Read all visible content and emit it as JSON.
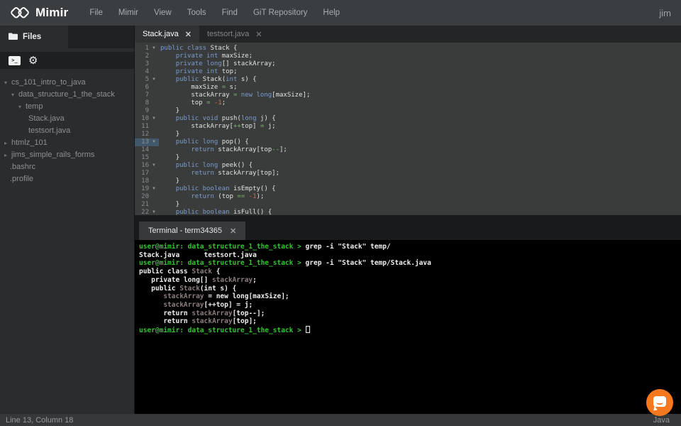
{
  "topbar": {
    "brand": "Mimir",
    "menus": [
      "File",
      "Mimir",
      "View",
      "Tools",
      "Find",
      "GiT Repository",
      "Help"
    ],
    "user": "jim"
  },
  "sidebar": {
    "files_tab": "Files",
    "toolbar_icons": [
      "terminal-icon",
      "gear-icon"
    ],
    "tree": [
      {
        "label": "cs_101_intro_to_java",
        "arrow": "down",
        "indent": 6
      },
      {
        "label": "data_structure_1_the_stack",
        "arrow": "down",
        "indent": 16
      },
      {
        "label": "temp",
        "arrow": "down",
        "indent": 26
      },
      {
        "label": "Stack.java",
        "arrow": "none",
        "indent": 40
      },
      {
        "label": "testsort.java",
        "arrow": "none",
        "indent": 40
      },
      {
        "label": "htmlz_101",
        "arrow": "right",
        "indent": 6
      },
      {
        "label": "jims_simple_rails_forms",
        "arrow": "right",
        "indent": 6
      },
      {
        "label": ".bashrc",
        "arrow": "none",
        "indent": 14
      },
      {
        "label": ".profile",
        "arrow": "none",
        "indent": 14
      }
    ]
  },
  "editor": {
    "tabs": [
      {
        "label": "Stack.java",
        "active": true
      },
      {
        "label": "testsort.java",
        "active": false
      }
    ],
    "active_line": 13,
    "fold_lines": [
      1,
      5,
      10,
      13,
      16,
      19,
      22
    ],
    "lines": [
      {
        "n": 1,
        "tokens": [
          [
            "k",
            "public"
          ],
          [
            "p",
            " "
          ],
          [
            "k",
            "class"
          ],
          [
            "p",
            " Stack {"
          ]
        ]
      },
      {
        "n": 2,
        "tokens": [
          [
            "p",
            "    "
          ],
          [
            "k",
            "private"
          ],
          [
            "p",
            " "
          ],
          [
            "k",
            "int"
          ],
          [
            "p",
            " maxSize;"
          ]
        ]
      },
      {
        "n": 3,
        "tokens": [
          [
            "p",
            "    "
          ],
          [
            "k",
            "private"
          ],
          [
            "p",
            " "
          ],
          [
            "k",
            "long"
          ],
          [
            "p",
            "[] stackArray;"
          ]
        ]
      },
      {
        "n": 4,
        "tokens": [
          [
            "p",
            "    "
          ],
          [
            "k",
            "private"
          ],
          [
            "p",
            " "
          ],
          [
            "k",
            "int"
          ],
          [
            "p",
            " top;"
          ]
        ]
      },
      {
        "n": 5,
        "tokens": [
          [
            "p",
            "    "
          ],
          [
            "k",
            "public"
          ],
          [
            "p",
            " Stack("
          ],
          [
            "k",
            "int"
          ],
          [
            "p",
            " s) {"
          ]
        ]
      },
      {
        "n": 6,
        "tokens": [
          [
            "p",
            "        maxSize "
          ],
          [
            "o",
            "="
          ],
          [
            "p",
            " s;"
          ]
        ]
      },
      {
        "n": 7,
        "tokens": [
          [
            "p",
            "        stackArray "
          ],
          [
            "o",
            "="
          ],
          [
            "p",
            " "
          ],
          [
            "k",
            "new"
          ],
          [
            "p",
            " "
          ],
          [
            "k",
            "long"
          ],
          [
            "p",
            "[maxSize];"
          ]
        ]
      },
      {
        "n": 8,
        "tokens": [
          [
            "p",
            "        top "
          ],
          [
            "o",
            "="
          ],
          [
            "p",
            " "
          ],
          [
            "n",
            "-1"
          ],
          [
            "p",
            ";"
          ]
        ]
      },
      {
        "n": 9,
        "tokens": [
          [
            "p",
            "    }"
          ]
        ]
      },
      {
        "n": 10,
        "tokens": [
          [
            "p",
            "    "
          ],
          [
            "k",
            "public"
          ],
          [
            "p",
            " "
          ],
          [
            "k",
            "void"
          ],
          [
            "p",
            " push("
          ],
          [
            "k",
            "long"
          ],
          [
            "p",
            " j) {"
          ]
        ]
      },
      {
        "n": 11,
        "tokens": [
          [
            "p",
            "        stackArray["
          ],
          [
            "o",
            "++"
          ],
          [
            "p",
            "top] "
          ],
          [
            "o",
            "="
          ],
          [
            "p",
            " j;"
          ]
        ]
      },
      {
        "n": 12,
        "tokens": [
          [
            "p",
            "    }"
          ]
        ]
      },
      {
        "n": 13,
        "tokens": [
          [
            "p",
            "    "
          ],
          [
            "k",
            "public"
          ],
          [
            "p",
            " "
          ],
          [
            "k",
            "long"
          ],
          [
            "p",
            " pop() {"
          ]
        ]
      },
      {
        "n": 14,
        "tokens": [
          [
            "p",
            "        "
          ],
          [
            "k",
            "return"
          ],
          [
            "p",
            " stackArray[top"
          ],
          [
            "o",
            "--"
          ],
          [
            "p",
            "];"
          ]
        ]
      },
      {
        "n": 15,
        "tokens": [
          [
            "p",
            "    }"
          ]
        ]
      },
      {
        "n": 16,
        "tokens": [
          [
            "p",
            "    "
          ],
          [
            "k",
            "public"
          ],
          [
            "p",
            " "
          ],
          [
            "k",
            "long"
          ],
          [
            "p",
            " peek() {"
          ]
        ]
      },
      {
        "n": 17,
        "tokens": [
          [
            "p",
            "        "
          ],
          [
            "k",
            "return"
          ],
          [
            "p",
            " stackArray[top];"
          ]
        ]
      },
      {
        "n": 18,
        "tokens": [
          [
            "p",
            "    }"
          ]
        ]
      },
      {
        "n": 19,
        "tokens": [
          [
            "p",
            "    "
          ],
          [
            "k",
            "public"
          ],
          [
            "p",
            " "
          ],
          [
            "k",
            "boolean"
          ],
          [
            "p",
            " isEmpty() {"
          ]
        ]
      },
      {
        "n": 20,
        "tokens": [
          [
            "p",
            "        "
          ],
          [
            "k",
            "return"
          ],
          [
            "p",
            " (top "
          ],
          [
            "o",
            "=="
          ],
          [
            "p",
            " "
          ],
          [
            "n",
            "-1"
          ],
          [
            "p",
            ");"
          ]
        ]
      },
      {
        "n": 21,
        "tokens": [
          [
            "p",
            "    }"
          ]
        ]
      },
      {
        "n": 22,
        "tokens": [
          [
            "p",
            "    "
          ],
          [
            "k",
            "public"
          ],
          [
            "p",
            " "
          ],
          [
            "k",
            "boolean"
          ],
          [
            "p",
            " isFull() {"
          ]
        ]
      }
    ]
  },
  "terminal": {
    "tab": "Terminal - term34365",
    "lines": [
      [
        [
          "g",
          "user@mimir: "
        ],
        [
          "gb",
          "data_structure_1_the_stack"
        ],
        [
          "g",
          " > "
        ],
        [
          "w",
          "grep -i \"Stack\" temp/"
        ]
      ],
      [
        [
          "w",
          "Stack.java      testsort.java"
        ]
      ],
      [
        [
          "g",
          "user@mimir: "
        ],
        [
          "gb",
          "data_structure_1_the_stack"
        ],
        [
          "g",
          " > "
        ],
        [
          "w",
          "grep -i \"Stack\" temp/Stack.java"
        ]
      ],
      [
        [
          "w",
          "public class "
        ],
        [
          "m",
          "Stack"
        ],
        [
          "w",
          " {"
        ]
      ],
      [
        [
          "w",
          "   private long[] "
        ],
        [
          "m",
          "stackArray"
        ],
        [
          "w",
          ";"
        ]
      ],
      [
        [
          "w",
          "   public "
        ],
        [
          "m",
          "Stack"
        ],
        [
          "w",
          "(int s) {"
        ]
      ],
      [
        [
          "w",
          "      "
        ],
        [
          "m",
          "stackArray"
        ],
        [
          "w",
          " = new long[maxSize];"
        ]
      ],
      [
        [
          "w",
          "      "
        ],
        [
          "m",
          "stackArray"
        ],
        [
          "w",
          "[++top] = j;"
        ]
      ],
      [
        [
          "w",
          "      return "
        ],
        [
          "m",
          "stackArray"
        ],
        [
          "w",
          "[top--];"
        ]
      ],
      [
        [
          "w",
          "      return "
        ],
        [
          "m",
          "stackArray"
        ],
        [
          "w",
          "[top];"
        ]
      ],
      [
        [
          "g",
          "user@mimir: "
        ],
        [
          "gb",
          "data_structure_1_the_stack"
        ],
        [
          "g",
          " > "
        ],
        [
          "cursor",
          ""
        ]
      ]
    ]
  },
  "statusbar": {
    "left": "Line 13, Column 18",
    "right": "Java"
  },
  "colors": {
    "topbar_bg": "#3b3e40",
    "editor_bg": "#3a3c3c",
    "keyword_blue": "#7b9bce",
    "operator_green": "#79b36a",
    "number_orange": "#cf7049",
    "terminal_green": "#35c435",
    "grep_match_dim": "#8e7e7e",
    "active_line_gutter": "#41576b",
    "chat_orange": "#f5781f"
  }
}
